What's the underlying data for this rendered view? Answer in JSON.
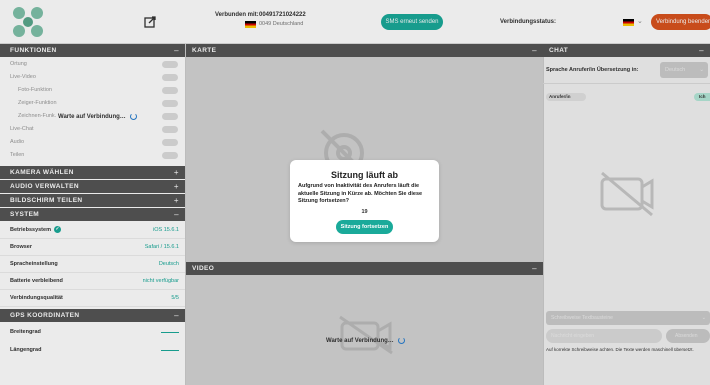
{
  "topbar": {
    "connected_label": "Verbunden mit:",
    "phone_number": "004917​21024222",
    "country": "0049 Deutschland",
    "sms_button": "SMS erneut senden",
    "status_label": "Verbindungsstatus:",
    "end_button": "Verbindung beenden"
  },
  "sidebar": {
    "functions": {
      "title": "FUNKTIONEN",
      "sign": "–",
      "items": [
        "Ortung",
        "Live-Video",
        "Foto-Funktion",
        "Zeiger-Funktion",
        "Zeichnen-Funk.",
        "Live-Chat",
        "Audio",
        "Teilen"
      ],
      "waiting": "Warte auf Verbindung…"
    },
    "camera": {
      "title": "KAMERA WÄHLEN",
      "sign": "+"
    },
    "audio": {
      "title": "AUDIO VERWALTEN",
      "sign": "+"
    },
    "screen": {
      "title": "BILDSCHIRM TEILEN",
      "sign": "+"
    },
    "system": {
      "title": "SYSTEM",
      "sign": "–",
      "rows": [
        {
          "label": "Betriebssystem",
          "value": "iOS 15.6.1"
        },
        {
          "label": "Browser",
          "value": "Safari / 15.6.1"
        },
        {
          "label": "Spracheinstellung",
          "value": "Deutsch"
        },
        {
          "label": "Batterie verbleibend",
          "value": "nicht verfügbar"
        },
        {
          "label": "Verbindungsqualität",
          "value": "5/5"
        }
      ]
    },
    "gps": {
      "title": "GPS KOORDINATEN",
      "sign": "–",
      "rows": [
        "Breitengrad",
        "Längengrad"
      ]
    }
  },
  "map": {
    "title": "KARTE",
    "sign": "–"
  },
  "video": {
    "title": "VIDEO",
    "sign": "–",
    "waiting": "Warte auf Verbindung…"
  },
  "chat": {
    "title": "CHAT",
    "sign": "–",
    "language_label": "Sprache Anrufer/in Übersetzung in:",
    "language_value": "Deutsch",
    "caller_tag": "Anrufer/in",
    "me_tag": "Ich",
    "style_placeholder": "Schreibweise Textbausteine",
    "message_placeholder": "Nachricht eingeben",
    "send_button": "Absenden",
    "note": "Auf korrekte Schreibweise achten. Die Texte werden maschinell übersetzt."
  },
  "modal": {
    "title": "Sitzung läuft ab",
    "text": "Aufgrund von Inaktivität des Anrufers läuft die aktuelle Sitzung in Kürze ab. Möchten Sie diese Sitzung fortsetzen?",
    "countdown": "19",
    "button": "Sitzung fortsetzen"
  },
  "colors": {
    "accent": "#1aaa9a",
    "danger": "#d9531e",
    "header": "#555555"
  }
}
